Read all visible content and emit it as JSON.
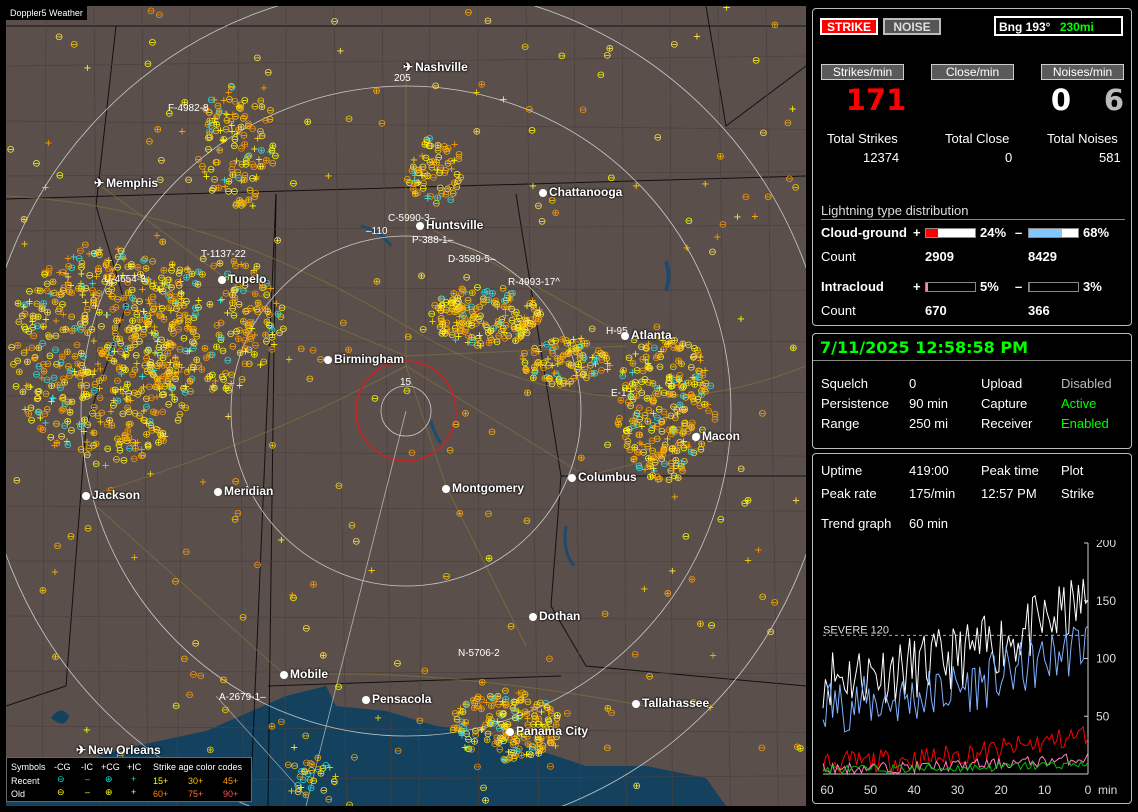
{
  "app": {
    "brand": "Doppler5 Weather"
  },
  "map": {
    "cities": [
      {
        "name": "Nashville",
        "icon": "airport"
      },
      {
        "name": "Memphis",
        "icon": "airport"
      },
      {
        "name": "Chattanooga",
        "icon": "dot"
      },
      {
        "name": "Huntsville",
        "icon": "dot"
      },
      {
        "name": "Tupelo",
        "icon": "dot"
      },
      {
        "name": "Birmingham",
        "icon": "dot"
      },
      {
        "name": "Atlanta",
        "icon": "dot"
      },
      {
        "name": "Macon",
        "icon": "dot"
      },
      {
        "name": "Jackson",
        "icon": "dot"
      },
      {
        "name": "Meridian",
        "icon": "dot"
      },
      {
        "name": "Montgomery",
        "icon": "dot"
      },
      {
        "name": "Columbus",
        "icon": "dot"
      },
      {
        "name": "Dothan",
        "icon": "dot"
      },
      {
        "name": "Mobile",
        "icon": "dot"
      },
      {
        "name": "Pensacola",
        "icon": "dot"
      },
      {
        "name": "Tallahassee",
        "icon": "dot"
      },
      {
        "name": "Panama City",
        "icon": "dot"
      },
      {
        "name": "New Orleans",
        "icon": "airport"
      }
    ],
    "storms": [
      "F-4982-8",
      "C-5990-3–",
      "–110",
      "P-388-1–",
      "D-3589-5–",
      "R-4993-17^",
      "T-1137-22",
      "U-4654-8",
      "H-95",
      "E-1",
      "N-5706-2",
      "A-2679-1–"
    ],
    "ring_labels": [
      "205",
      "15"
    ]
  },
  "legend": {
    "symbols_label": "Symbols",
    "headers": [
      "-CG",
      "-IC",
      "+CG",
      "+IC"
    ],
    "age_title": "Strike age color codes",
    "recent_label": "Recent",
    "old_label": "Old",
    "recent_ages": [
      "15+",
      "30+",
      "45+"
    ],
    "old_ages": [
      "60+",
      "75+",
      "90+"
    ]
  },
  "status": {
    "strike_button": "STRIKE",
    "noise_button": "NOISE",
    "bearing": "Bng 193°",
    "distance": "230mi"
  },
  "rates": {
    "strikes_header": "Strikes/min",
    "close_header": "Close/min",
    "noises_header": "Noises/min",
    "strikes_value": "171",
    "close_value": "0",
    "noises_value": "6",
    "total_strikes_label": "Total Strikes",
    "total_close_label": "Total Close",
    "total_noises_label": "Total Noises",
    "total_strikes": "12374",
    "total_close": "0",
    "total_noises": "581"
  },
  "distribution": {
    "title": "Lightning type distribution",
    "cg_label": "Cloud-ground",
    "ic_label": "Intracloud",
    "count_label": "Count",
    "plus": "+",
    "minus": "–",
    "cg_pos_pct": "24%",
    "cg_neg_pct": "68%",
    "cg_pos_count": "2909",
    "cg_neg_count": "8429",
    "ic_pos_pct": "5%",
    "ic_neg_pct": "3%",
    "ic_pos_count": "670",
    "ic_neg_count": "366",
    "fractions": {
      "cg_pos": 0.24,
      "cg_neg": 0.68,
      "ic_pos": 0.05,
      "ic_neg": 0.03
    },
    "colors": {
      "cg_pos": "#ff0000",
      "cg_neg": "#80c8ff",
      "ic_pos": "#ff80c0",
      "ic_neg": "#00c000"
    }
  },
  "settings": {
    "datetime": "7/11/2025 12:58:58 PM",
    "squelch_label": "Squelch",
    "squelch": "0",
    "persistence_label": "Persistence",
    "persistence": "90 min",
    "range_label": "Range",
    "range": "250 mi",
    "upload_label": "Upload",
    "upload": "Disabled",
    "capture_label": "Capture",
    "capture": "Active",
    "receiver_label": "Receiver",
    "receiver": "Enabled"
  },
  "stats": {
    "uptime_label": "Uptime",
    "uptime": "419:00",
    "peak_time_label": "Peak time",
    "peak_time": "12:57 PM",
    "plot_label": "Plot",
    "plot": "Strike",
    "peak_rate_label": "Peak rate",
    "peak_rate": "175/min",
    "trend_label": "Trend graph",
    "trend": "60 min"
  },
  "chart_data": {
    "type": "line",
    "severe_label": "SEVERE 120",
    "severe_value": 120,
    "ylim": [
      0,
      200
    ],
    "y_ticks": [
      "200",
      "150",
      "100",
      "50"
    ],
    "x_ticks": [
      "60",
      "50",
      "40",
      "30",
      "20",
      "10",
      "0"
    ],
    "x_unit": "min",
    "series_colors": [
      "#ffffff",
      "#80b0ff",
      "#ff0000",
      "#ff80c0",
      "#00c000"
    ]
  }
}
